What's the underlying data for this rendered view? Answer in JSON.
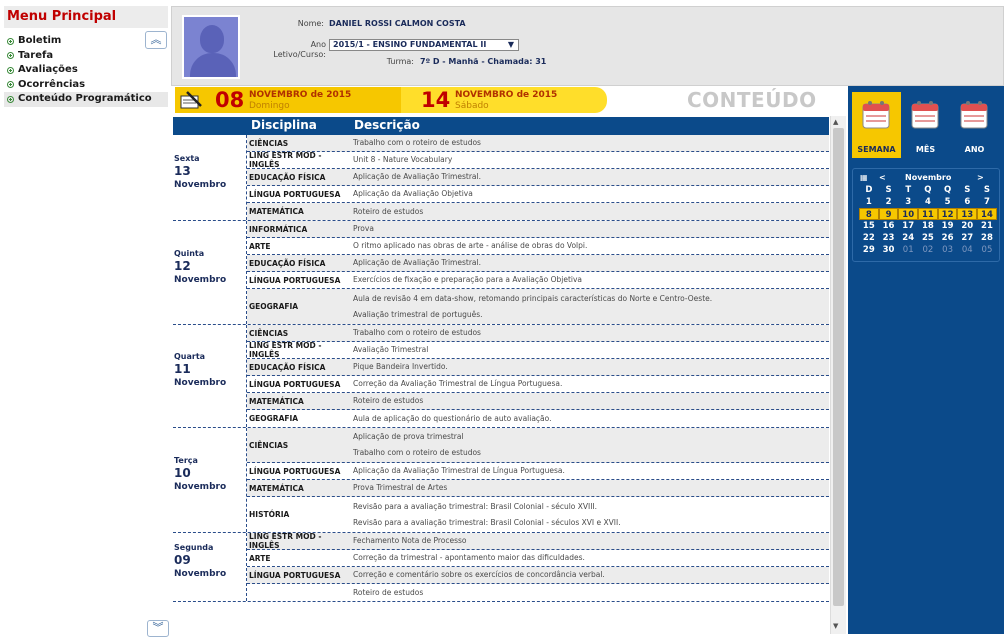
{
  "menu": {
    "title": "Menu Principal",
    "items": [
      {
        "label": "Boletim"
      },
      {
        "label": "Tarefa"
      },
      {
        "label": "Avaliações"
      },
      {
        "label": "Ocorrências"
      },
      {
        "label": "Conteúdo Programático"
      }
    ]
  },
  "header": {
    "nome_label": "Nome:",
    "nome": "DANIEL ROSSI CALMON COSTA",
    "ano_label": "Ano",
    "letivo_label": "Letivo/Curso:",
    "ano_value": "2015/1 - ENSINO FUNDAMENTAL II",
    "turma_label": "Turma:",
    "turma": "7º D - Manhã - Chamada: 31"
  },
  "datebar": {
    "start_num": "08",
    "start_month": "NOVEMBRO de 2015",
    "start_day": "Domingo",
    "end_num": "14",
    "end_month": "NOVEMBRO de 2015",
    "end_day": "Sábado",
    "section_title": "CONTEÚDO"
  },
  "table": {
    "col_disciplina": "Disciplina",
    "col_descricao": "Descrição"
  },
  "days": [
    {
      "weekday": "Sexta",
      "num": "13",
      "month": "Novembro",
      "rows": [
        {
          "disc": "CIÊNCIAS",
          "desc": [
            "Trabalho com o roteiro de estudos"
          ]
        },
        {
          "disc": "LING ESTR MOD - INGLÊS",
          "desc": [
            "Unit 8 - Nature Vocabulary"
          ]
        },
        {
          "disc": "EDUCAÇÃO FÍSICA",
          "desc": [
            "Aplicação de Avaliação Trimestral."
          ]
        },
        {
          "disc": "LÍNGUA PORTUGUESA",
          "desc": [
            "Aplicação da Avaliação Objetiva"
          ]
        },
        {
          "disc": "MATEMÁTICA",
          "desc": [
            "Roteiro de estudos"
          ]
        }
      ]
    },
    {
      "weekday": "Quinta",
      "num": "12",
      "month": "Novembro",
      "rows": [
        {
          "disc": "INFORMÁTICA",
          "desc": [
            "Prova"
          ]
        },
        {
          "disc": "ARTE",
          "desc": [
            "O ritmo aplicado nas obras de arte - análise de obras do Volpi."
          ]
        },
        {
          "disc": "EDUCAÇÃO FÍSICA",
          "desc": [
            "Aplicação de Avaliação Trimestral."
          ]
        },
        {
          "disc": "LÍNGUA PORTUGUESA",
          "desc": [
            "Exercícios de fixação e preparação para a Avaliação Objetiva"
          ]
        },
        {
          "disc": "GEOGRAFIA",
          "desc": [
            "Aula de revisão 4 em data-show, retomando principais características do Norte e Centro-Oeste.",
            "Avaliação trimestral de português."
          ]
        }
      ]
    },
    {
      "weekday": "Quarta",
      "num": "11",
      "month": "Novembro",
      "rows": [
        {
          "disc": "CIÊNCIAS",
          "desc": [
            "Trabalho com o roteiro de estudos"
          ]
        },
        {
          "disc": "LING ESTR MOD - INGLÊS",
          "desc": [
            "Avaliação Trimestral"
          ]
        },
        {
          "disc": "EDUCAÇÃO FÍSICA",
          "desc": [
            "Pique Bandeira Invertido."
          ]
        },
        {
          "disc": "LÍNGUA PORTUGUESA",
          "desc": [
            "Correção da Avaliação Trimestral de Língua Portuguesa."
          ]
        },
        {
          "disc": "MATEMÁTICA",
          "desc": [
            "Roteiro de estudos"
          ]
        },
        {
          "disc": "GEOGRAFIA",
          "desc": [
            "Aula de aplicação do questionário de auto avaliação."
          ]
        }
      ]
    },
    {
      "weekday": "Terça",
      "num": "10",
      "month": "Novembro",
      "rows": [
        {
          "disc": "CIÊNCIAS",
          "desc": [
            "Aplicação de prova trimestral",
            "Trabalho com o roteiro de estudos"
          ]
        },
        {
          "disc": "LÍNGUA PORTUGUESA",
          "desc": [
            "Aplicação da Avaliação Trimestral de Língua Portuguesa."
          ]
        },
        {
          "disc": "MATEMÁTICA",
          "desc": [
            "Prova Trimestral de Artes"
          ]
        },
        {
          "disc": "HISTÓRIA",
          "desc": [
            "Revisão para a avaliação trimestral: Brasil Colonial - século XVIII.",
            "Revisão para a avaliação trimestral: Brasil Colonial - séculos XVI e XVII."
          ]
        }
      ]
    },
    {
      "weekday": "Segunda",
      "num": "09",
      "month": "Novembro",
      "rows": [
        {
          "disc": "LING ESTR MOD - INGLÊS",
          "desc": [
            "Fechamento Nota de Processo"
          ]
        },
        {
          "disc": "ARTE",
          "desc": [
            "Correção da trimestral - apontamento maior das dificuldades."
          ]
        },
        {
          "disc": "LÍNGUA PORTUGUESA",
          "desc": [
            "Correção e comentário sobre os exercícios de concordância verbal."
          ]
        },
        {
          "disc": "",
          "desc": [
            "Roteiro de estudos"
          ]
        }
      ]
    }
  ],
  "views": {
    "semana": "SEMANA",
    "mes": "MÊS",
    "ano": "ANO"
  },
  "calendar": {
    "prev": "<",
    "month": "Novembro",
    "next": ">",
    "weekdays": [
      "D",
      "S",
      "T",
      "Q",
      "Q",
      "S",
      "S"
    ],
    "weeks": [
      [
        "1",
        "2",
        "3",
        "4",
        "5",
        "6",
        "7"
      ],
      [
        "8",
        "9",
        "10",
        "11",
        "12",
        "13",
        "14"
      ],
      [
        "15",
        "16",
        "17",
        "18",
        "19",
        "20",
        "21"
      ],
      [
        "22",
        "23",
        "24",
        "25",
        "26",
        "27",
        "28"
      ],
      [
        "29",
        "30",
        "01",
        "02",
        "03",
        "04",
        "05"
      ]
    ],
    "selected_week": 1,
    "colors": {
      "accent": "#f6c700",
      "panel": "#0b4a8a"
    }
  }
}
